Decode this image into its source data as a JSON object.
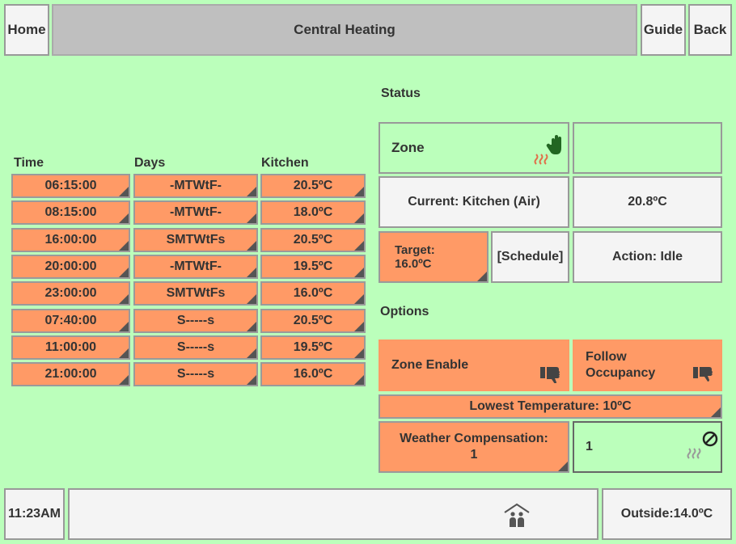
{
  "header": {
    "home_label": "Home",
    "title": "Central Heating",
    "guide_label": "Guide",
    "back_label": "Back"
  },
  "schedule": {
    "columns": [
      "Time",
      "Days",
      "Kitchen"
    ],
    "rows": [
      [
        "06:15:00",
        "-MTWtF-",
        "20.5ºC"
      ],
      [
        "08:15:00",
        "-MTWtF-",
        "18.0ºC"
      ],
      [
        "16:00:00",
        "SMTWtFs",
        "20.5ºC"
      ],
      [
        "20:00:00",
        "-MTWtF-",
        "19.5ºC"
      ],
      [
        "23:00:00",
        "SMTWtFs",
        "16.0ºC"
      ],
      [
        "07:40:00",
        "S-----s",
        "20.5ºC"
      ],
      [
        "11:00:00",
        "S-----s",
        "19.5ºC"
      ],
      [
        "21:00:00",
        "S-----s",
        "16.0ºC"
      ]
    ]
  },
  "status": {
    "heading": "Status",
    "zone_label": "Zone",
    "current_label": "Current: Kitchen (Air)",
    "current_value": "20.8ºC",
    "target_label": "Target:",
    "target_value": "16.0ºC",
    "schedule_label": "[Schedule]",
    "action_label": "Action: Idle"
  },
  "options": {
    "heading": "Options",
    "zone_enable_label": "Zone Enable",
    "follow_occupancy_label": "Follow Occupancy",
    "lowest_temp_label": "Lowest Temperature: 10ºC",
    "weather_comp_label": "Weather Compensation: 1",
    "weather_comp_value": "1"
  },
  "footer": {
    "time": "11:23AM",
    "outside": "Outside:14.0ºC"
  },
  "colors": {
    "background": "#bbffbb",
    "accent": "#ff9a66"
  }
}
